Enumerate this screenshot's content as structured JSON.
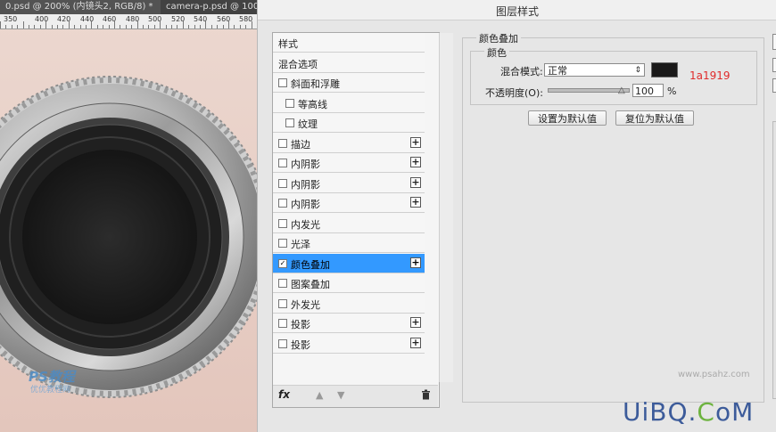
{
  "document_tabs": [
    {
      "label": "0.psd @ 200% (内镜头2, RGB/8) *",
      "close": "×"
    },
    {
      "label": "camera-p.psd @ 100",
      "close": ""
    }
  ],
  "ruler": {
    "labels": [
      "350",
      "400",
      "420",
      "440",
      "460",
      "480",
      "500",
      "520",
      "540",
      "560",
      "580"
    ]
  },
  "watermark": {
    "text": "PS教程",
    "subtext": "优优教程网"
  },
  "dialog": {
    "title": "图层样式",
    "styles_list": [
      {
        "label": "样式",
        "checkbox": false,
        "checked": false,
        "plus": false,
        "indent": false,
        "selected": false
      },
      {
        "label": "混合选项",
        "checkbox": false,
        "checked": false,
        "plus": false,
        "indent": false,
        "selected": false
      },
      {
        "label": "斜面和浮雕",
        "checkbox": true,
        "checked": false,
        "plus": false,
        "indent": false,
        "selected": false
      },
      {
        "label": "等高线",
        "checkbox": true,
        "checked": false,
        "plus": false,
        "indent": true,
        "selected": false
      },
      {
        "label": "纹理",
        "checkbox": true,
        "checked": false,
        "plus": false,
        "indent": true,
        "selected": false
      },
      {
        "label": "描边",
        "checkbox": true,
        "checked": false,
        "plus": true,
        "indent": false,
        "selected": false
      },
      {
        "label": "内阴影",
        "checkbox": true,
        "checked": false,
        "plus": true,
        "indent": false,
        "selected": false
      },
      {
        "label": "内阴影",
        "checkbox": true,
        "checked": false,
        "plus": true,
        "indent": false,
        "selected": false
      },
      {
        "label": "内阴影",
        "checkbox": true,
        "checked": false,
        "plus": true,
        "indent": false,
        "selected": false
      },
      {
        "label": "内发光",
        "checkbox": true,
        "checked": false,
        "plus": false,
        "indent": false,
        "selected": false
      },
      {
        "label": "光泽",
        "checkbox": true,
        "checked": false,
        "plus": false,
        "indent": false,
        "selected": false
      },
      {
        "label": "颜色叠加",
        "checkbox": true,
        "checked": true,
        "plus": true,
        "indent": false,
        "selected": true
      },
      {
        "label": "图案叠加",
        "checkbox": true,
        "checked": false,
        "plus": false,
        "indent": false,
        "selected": false
      },
      {
        "label": "外发光",
        "checkbox": true,
        "checked": false,
        "plus": false,
        "indent": false,
        "selected": false
      },
      {
        "label": "投影",
        "checkbox": true,
        "checked": false,
        "plus": true,
        "indent": false,
        "selected": false
      },
      {
        "label": "投影",
        "checkbox": true,
        "checked": false,
        "plus": true,
        "indent": false,
        "selected": false
      }
    ],
    "bottom": {
      "fx": "fx",
      "up": "▲",
      "down": "▼",
      "trash": "🗑"
    },
    "color_overlay": {
      "section_title": "颜色叠加",
      "group_title": "颜色",
      "blend_mode_label": "混合模式:",
      "blend_mode_value": "正常",
      "swatch_color": "#1a1919",
      "hex_annotation": "1a1919",
      "opacity_label": "不透明度(O):",
      "opacity_value": "100",
      "opacity_unit": "%",
      "opacity_level": 1.0,
      "make_default_button": "设置为默认值",
      "reset_default_button": "复位为默认值"
    }
  },
  "site_watermark": "www.psahz.com",
  "brand_watermark": {
    "part1": "UiBQ.",
    "part2": "C",
    "part3": "oM"
  },
  "colors": {
    "selection": "#3399ff",
    "hex_annotation": "#e02b2b",
    "swatch": "#1a1919"
  }
}
